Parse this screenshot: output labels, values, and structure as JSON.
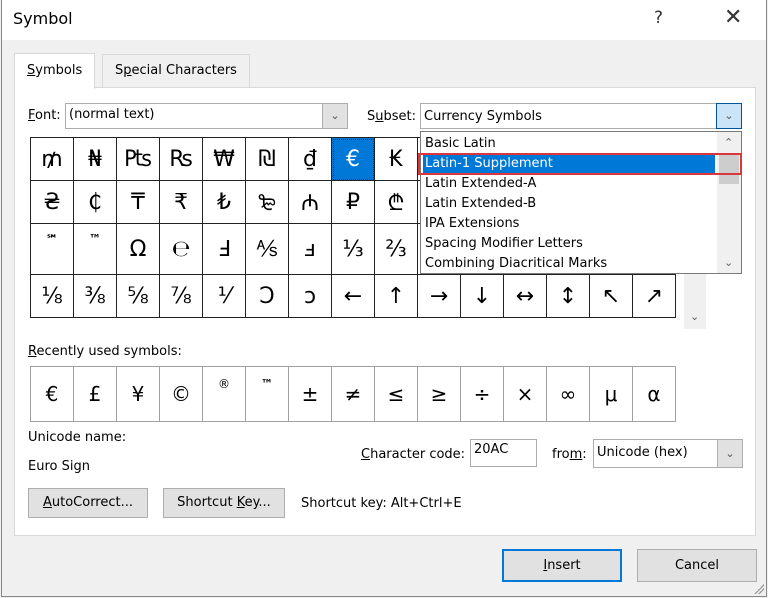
{
  "window": {
    "title": "Symbol",
    "help_label": "?",
    "close_label": "✕"
  },
  "tabs": [
    {
      "label_u": "S",
      "label_rest": "ymbols",
      "active": true
    },
    {
      "label_pre": "S",
      "label_u": "p",
      "label_rest": "ecial Characters",
      "active": false
    }
  ],
  "font": {
    "label_u": "F",
    "label_rest": "ont:",
    "value": "(normal text)"
  },
  "subset": {
    "label_pre": "S",
    "label_u": "u",
    "label_rest": "bset:",
    "value": "Currency Symbols",
    "options": [
      "Basic Latin",
      "Latin-1 Supplement",
      "Latin Extended-A",
      "Latin Extended-B",
      "IPA Extensions",
      "Spacing Modifier Letters",
      "Combining Diacritical Marks"
    ],
    "highlighted": "Latin-1 Supplement"
  },
  "symbol_grid": {
    "rows": [
      [
        "₥",
        "₦",
        "₧",
        "₨",
        "₩",
        "₪",
        "₫",
        "€",
        "₭",
        "",
        "",
        "",
        "",
        "",
        ""
      ],
      [
        "₴",
        "₵",
        "₸",
        "₹",
        "₺",
        "₻",
        "₼",
        "₽",
        "₾",
        "",
        "",
        "",
        "",
        "",
        ""
      ],
      [
        "℠",
        "™",
        "Ω",
        "℮",
        "Ⅎ",
        "⅍",
        "ⅎ",
        "⅓",
        "⅔",
        "",
        "",
        "",
        "",
        "",
        ""
      ],
      [
        "⅛",
        "⅜",
        "⅝",
        "⅞",
        "⅟",
        "Ↄ",
        "ↄ",
        "←",
        "↑",
        "→",
        "↓",
        "↔",
        "↕",
        "↖",
        "↗"
      ]
    ],
    "selected": "€"
  },
  "recent": {
    "label_u": "R",
    "label_rest": "ecently used symbols:",
    "symbols": [
      "€",
      "£",
      "¥",
      "©",
      "®",
      "™",
      "±",
      "≠",
      "≤",
      "≥",
      "÷",
      "×",
      "∞",
      "μ",
      "α"
    ]
  },
  "unicode_name": {
    "label": "Unicode name:",
    "value": "Euro Sign"
  },
  "char_code": {
    "label_u": "C",
    "label_rest": "haracter code:",
    "value": "20AC"
  },
  "from": {
    "label_pre": "fro",
    "label_u": "m",
    "label_rest": ":",
    "value": "Unicode (hex)"
  },
  "buttons": {
    "autocorrect_u": "A",
    "autocorrect_rest": "utoCorrect...",
    "shortcut_pre": "Shortcut ",
    "shortcut_u": "K",
    "shortcut_rest": "ey...",
    "insert_u": "I",
    "insert_rest": "nsert",
    "cancel": "Cancel"
  },
  "shortcut_text": "Shortcut key: Alt+Ctrl+E"
}
